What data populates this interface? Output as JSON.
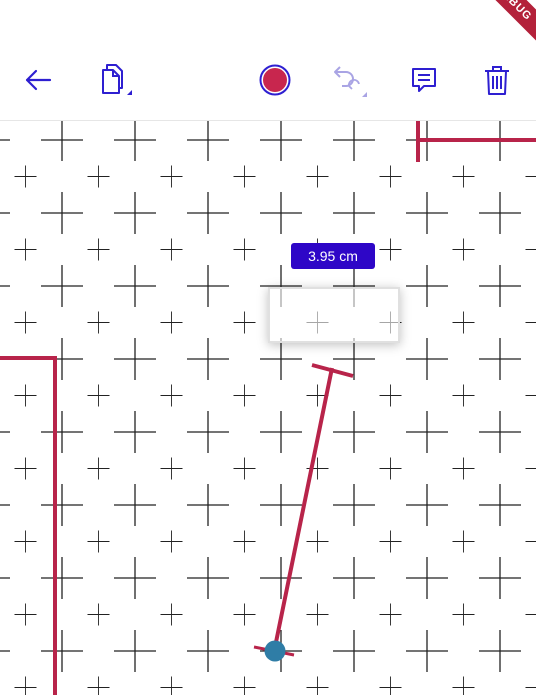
{
  "banner": {
    "text": "DEBUG"
  },
  "toolbar": {
    "back": {
      "icon": "arrow-left-icon"
    },
    "copy": {
      "icon": "copy-pages-icon"
    },
    "record": {
      "icon": "record-icon"
    },
    "undo": {
      "icon": "undo-redo-icon",
      "enabled": false
    },
    "comment": {
      "icon": "comment-icon"
    },
    "delete": {
      "icon": "trash-icon"
    }
  },
  "measurement": {
    "label": "3.95 cm"
  },
  "colors": {
    "icon": "#2e1fd1",
    "icon_disabled": "#a9a4e4",
    "record_fill": "#c8264e",
    "wall": "#b8244a",
    "label_bg": "#2e06c7",
    "handle": "#2f7da6",
    "grid": "#222222",
    "banner": "#b3213a"
  }
}
